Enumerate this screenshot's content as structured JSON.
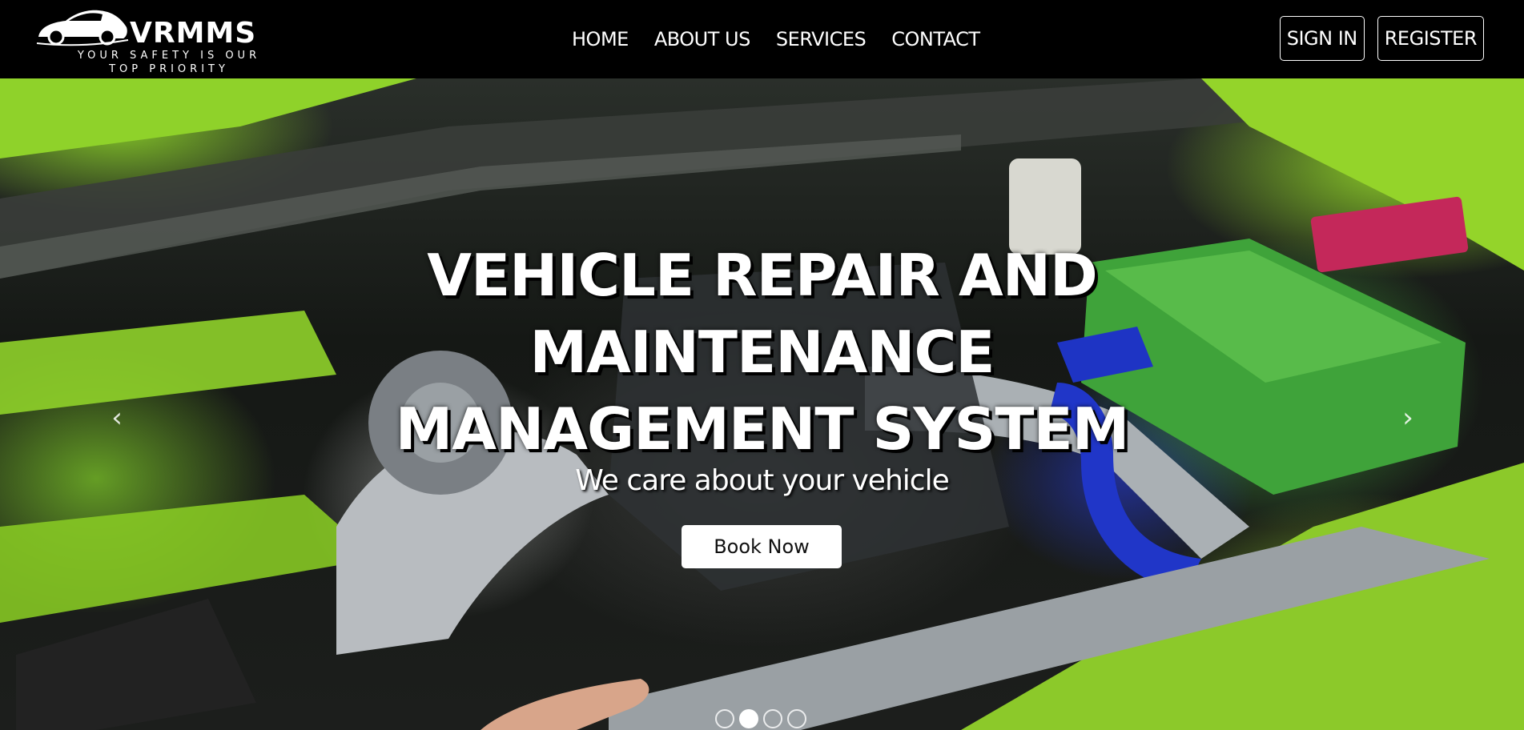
{
  "brand": {
    "name": "VRMMS",
    "tagline_line1": "YOUR SAFETY IS OUR",
    "tagline_line2": "TOP PRIORITY"
  },
  "nav": {
    "items": [
      {
        "label": "HOME"
      },
      {
        "label": "ABOUT US"
      },
      {
        "label": "SERVICES"
      },
      {
        "label": "CONTACT"
      }
    ]
  },
  "auth": {
    "sign_in": "SIGN IN",
    "register": "REGISTER"
  },
  "hero": {
    "title_line1": "VEHICLE REPAIR AND",
    "title_line2": "MAINTENANCE",
    "title_line3": "MANAGEMENT SYSTEM",
    "subtitle": "We care about your vehicle",
    "cta": "Book Now",
    "image_desc": "engine-bay-photo"
  },
  "carousel": {
    "prev_icon": "chevron-left-icon",
    "next_icon": "chevron-right-icon",
    "active_slide": 2,
    "slide_count": 4
  },
  "colors": {
    "navbar_bg": "#000000",
    "text": "#ffffff",
    "button_bg": "#ffffff"
  }
}
